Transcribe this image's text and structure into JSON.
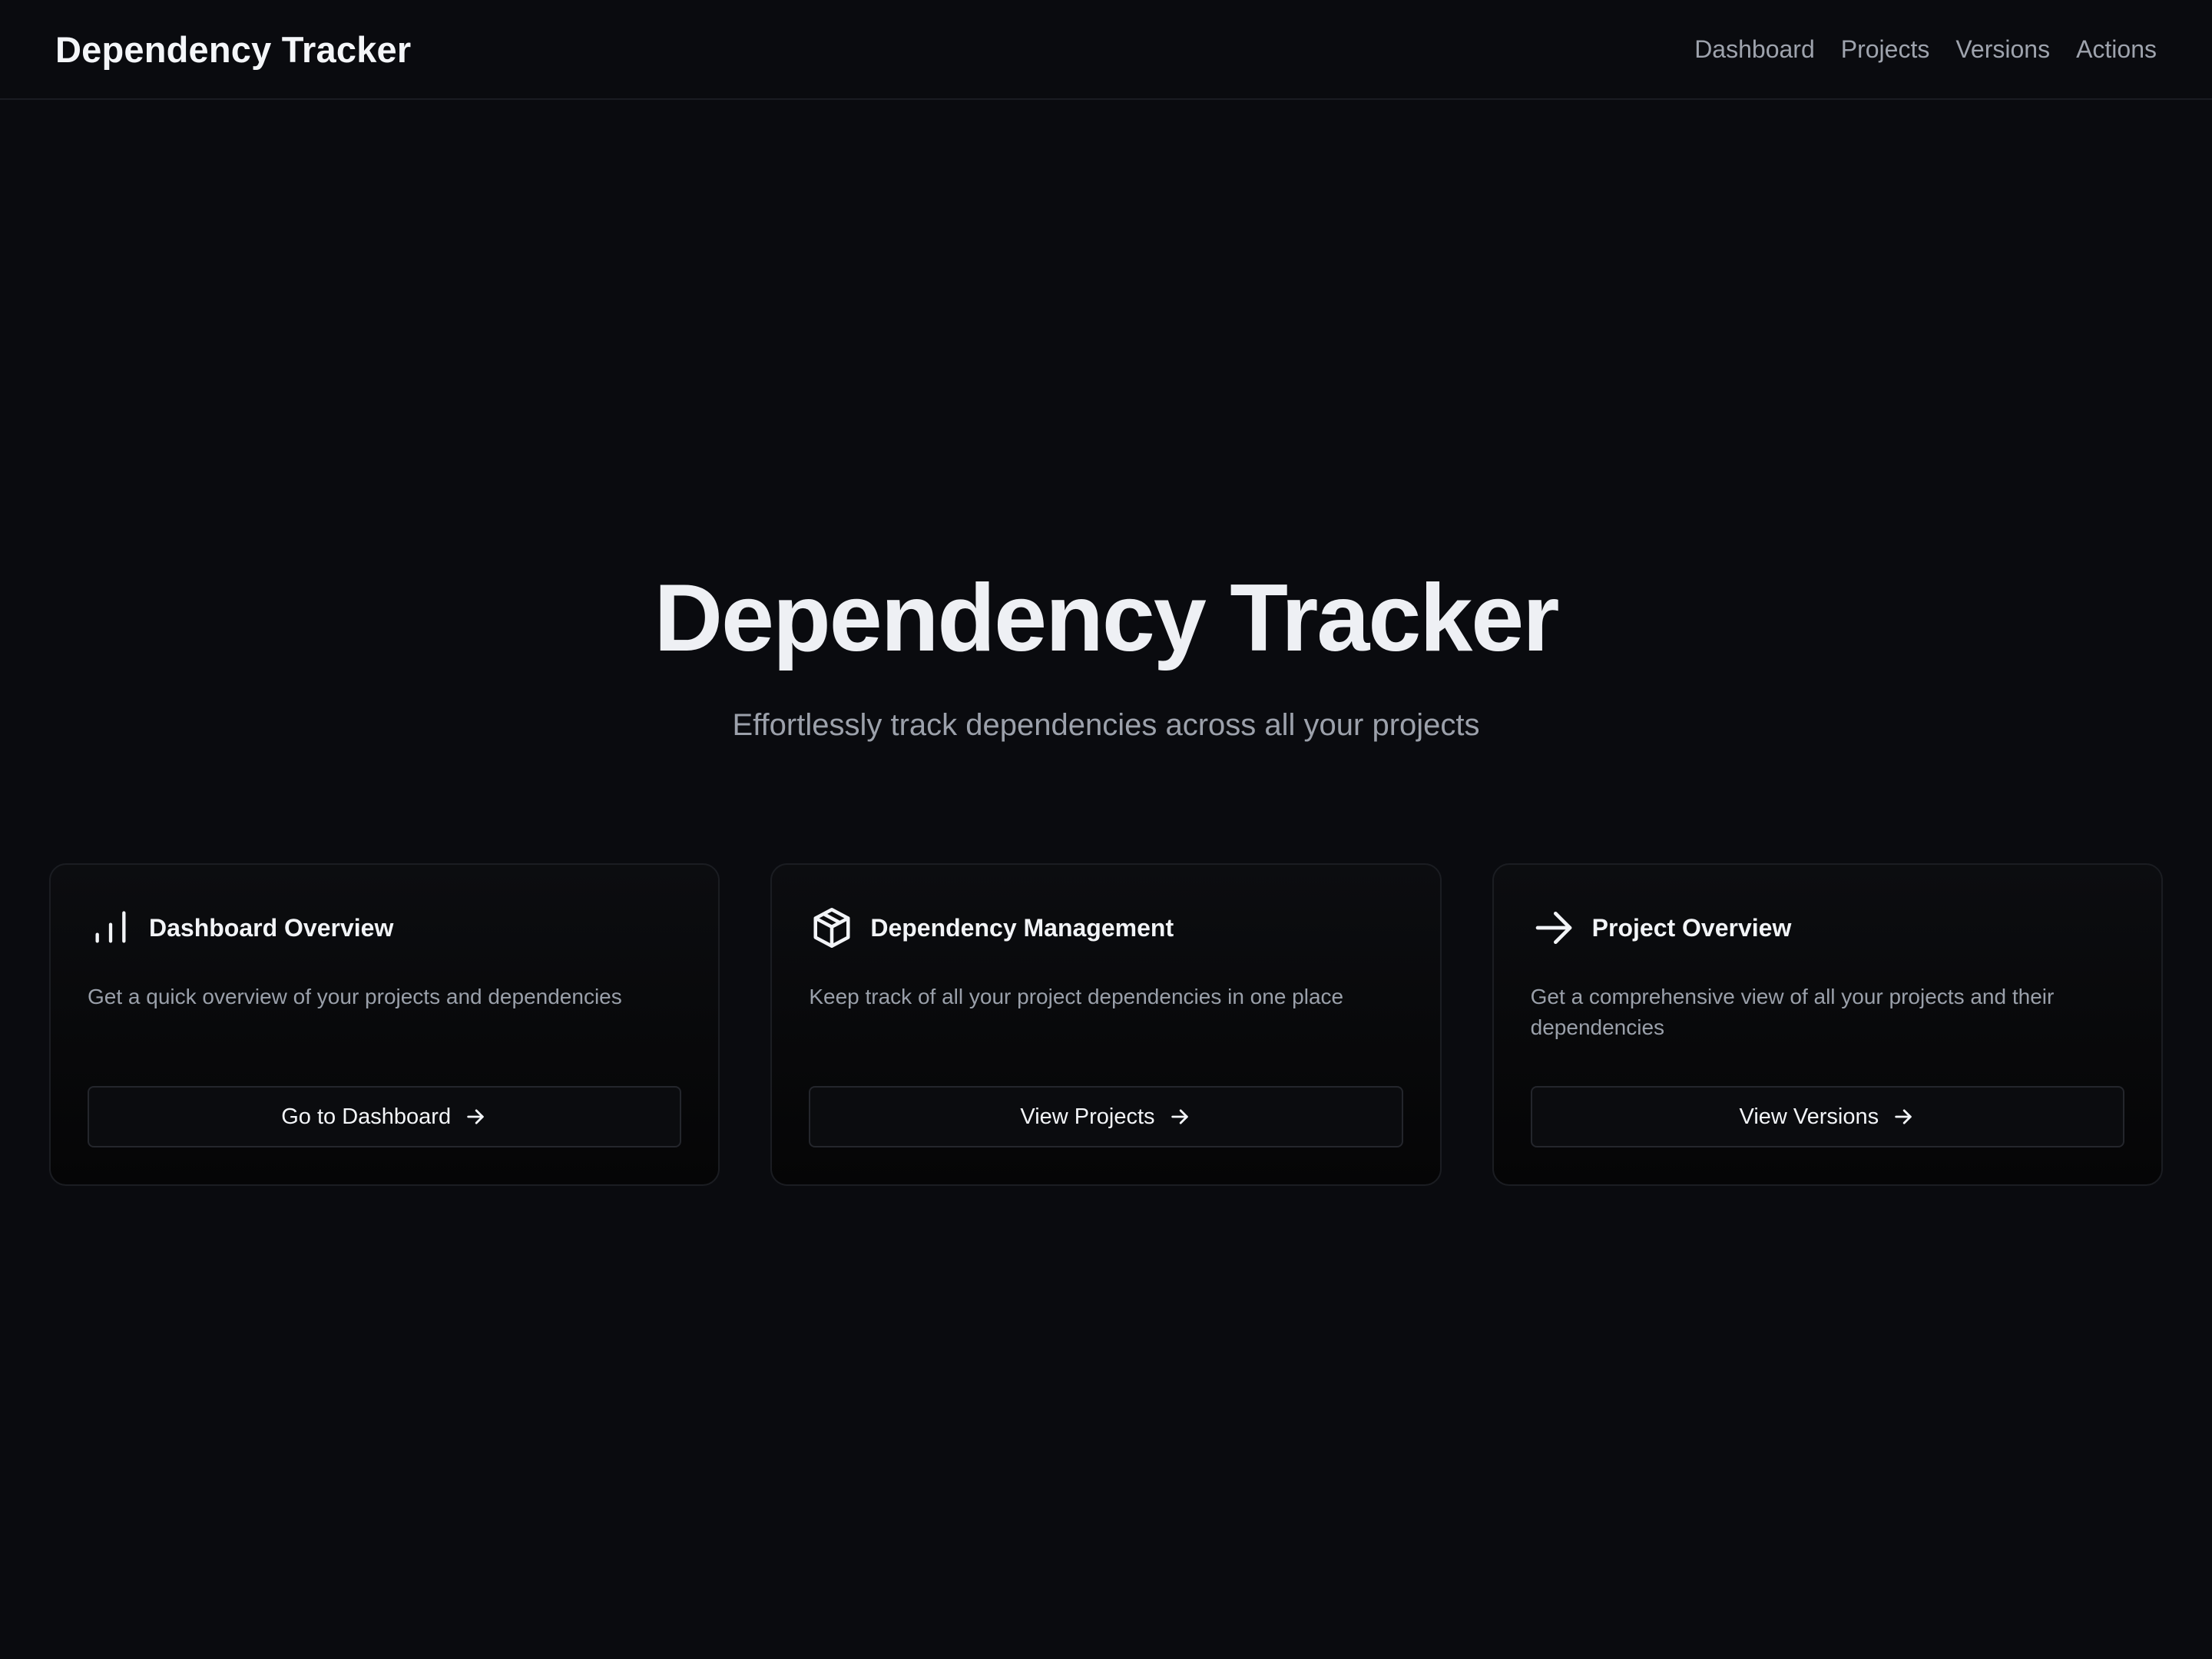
{
  "header": {
    "brand": "Dependency Tracker",
    "nav": [
      "Dashboard",
      "Projects",
      "Versions",
      "Actions"
    ]
  },
  "hero": {
    "title": "Dependency Tracker",
    "subtitle": "Effortlessly track dependencies across all your projects"
  },
  "cards": [
    {
      "icon": "bar-chart-icon",
      "title": "Dashboard Overview",
      "description": "Get a quick overview of your projects and dependencies",
      "button": "Go to Dashboard"
    },
    {
      "icon": "package-icon",
      "title": "Dependency Management",
      "description": "Keep track of all your project dependencies in one place",
      "button": "View Projects"
    },
    {
      "icon": "arrow-right-icon",
      "title": "Project Overview",
      "description": "Get a comprehensive view of all your projects and their dependencies",
      "button": "View Versions"
    }
  ],
  "colors": {
    "background": "#0a0b0f",
    "text_primary": "#f1f3f7",
    "text_muted": "#9ca1ab",
    "border": "#1b1d22"
  }
}
